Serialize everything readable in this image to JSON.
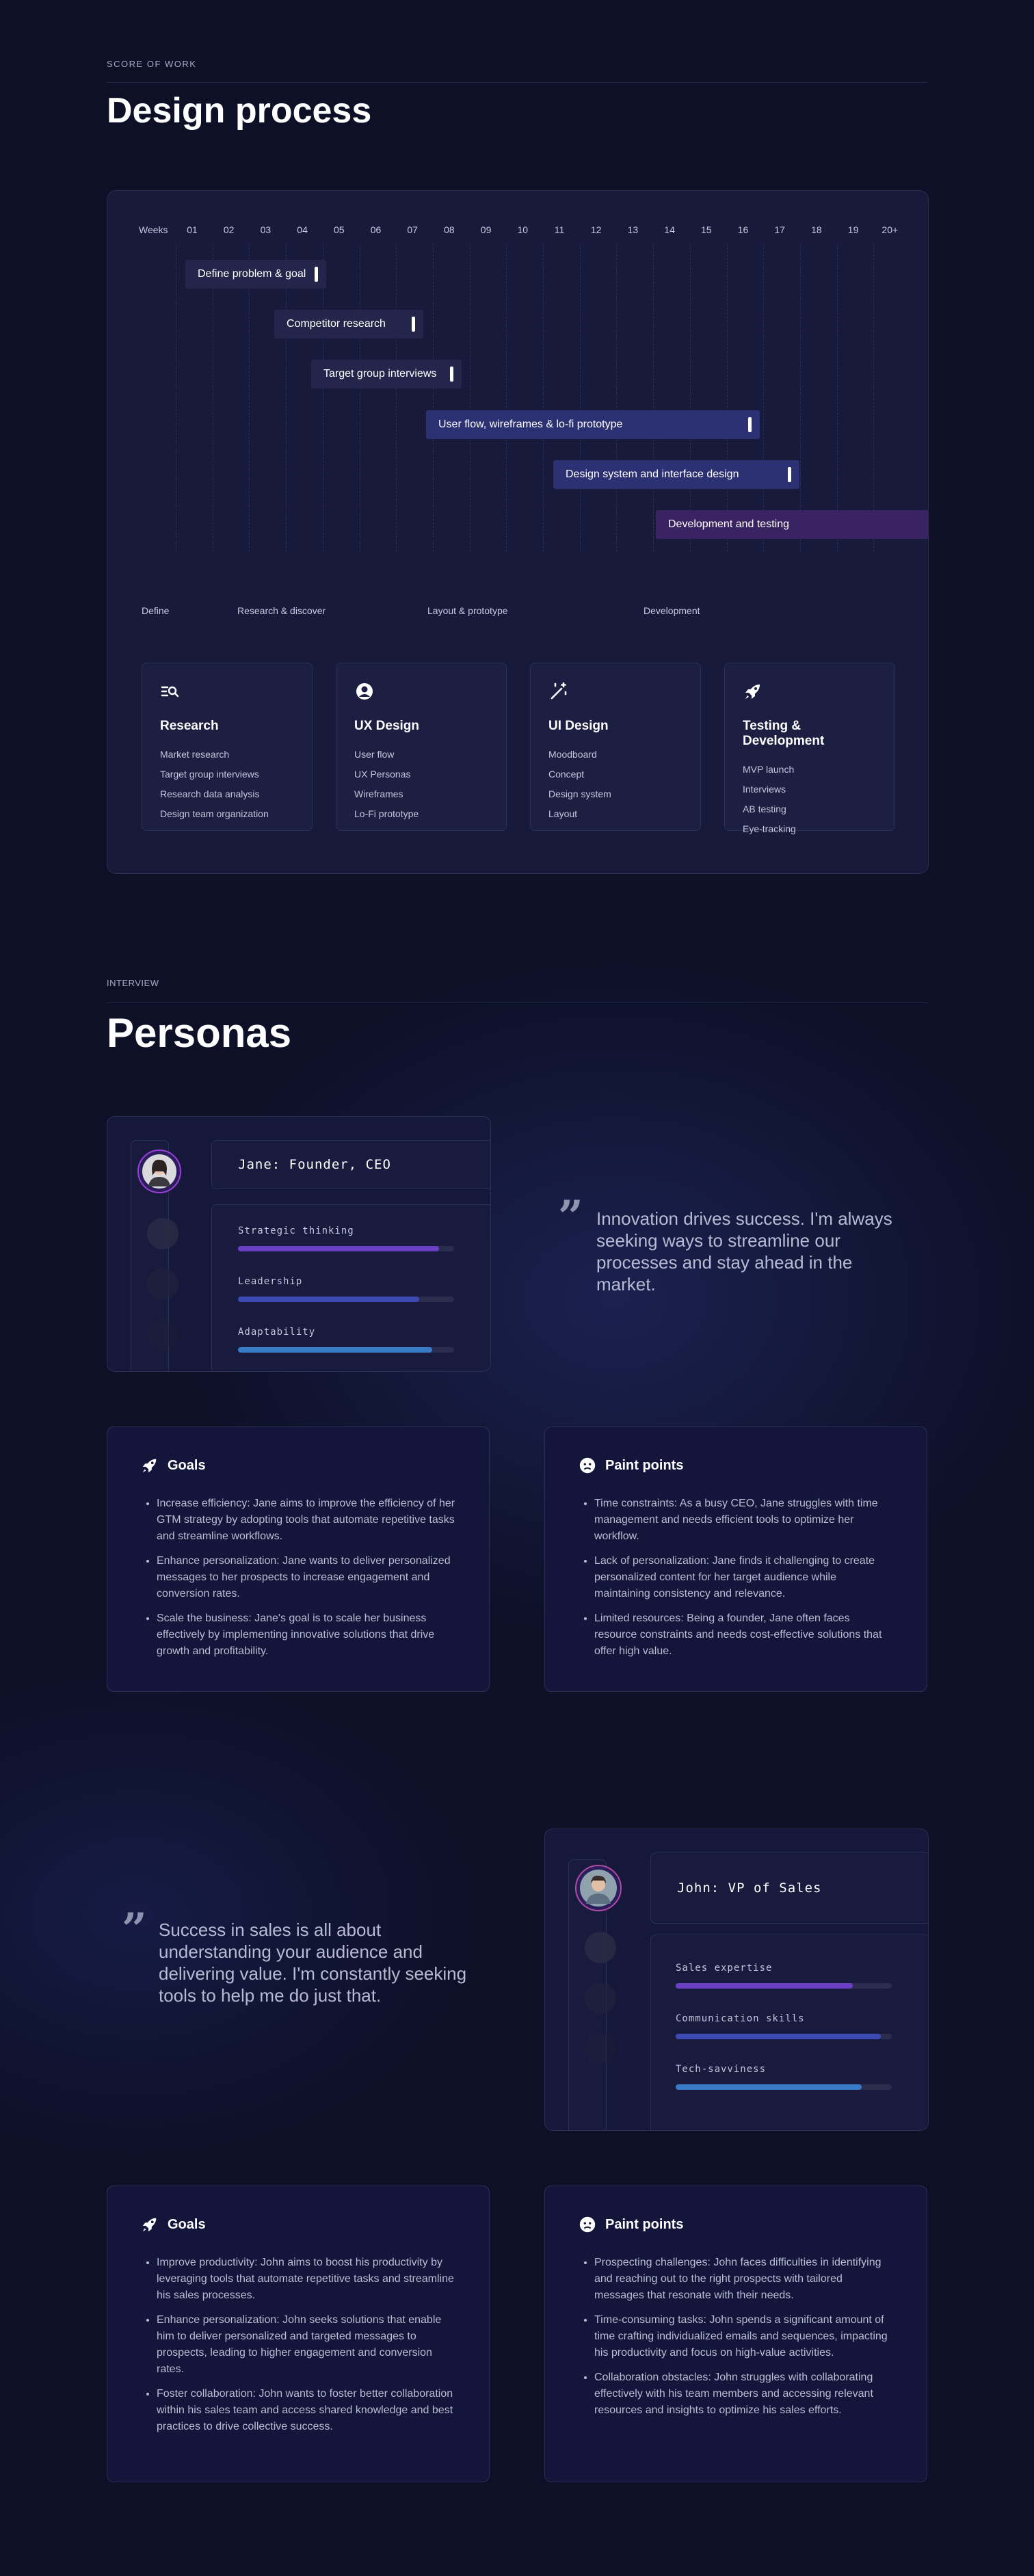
{
  "section1": {
    "eyebrow": "SCORE OF WORK",
    "title": "Design process"
  },
  "gantt": {
    "weeks_label": "Weeks",
    "weeks": [
      "01",
      "02",
      "03",
      "04",
      "05",
      "06",
      "07",
      "08",
      "09",
      "10",
      "11",
      "12",
      "13",
      "14",
      "15",
      "16",
      "17",
      "18",
      "19",
      "20+"
    ],
    "bars": [
      {
        "label": "Define problem & goal"
      },
      {
        "label": "Competitor research"
      },
      {
        "label": "Target group interviews"
      },
      {
        "label": "User flow, wireframes & lo-fi prototype"
      },
      {
        "label": "Design system and interface design"
      },
      {
        "label": "Development and testing"
      }
    ],
    "phases": [
      "Define",
      "Research & discover",
      "Layout & prototype",
      "Development"
    ],
    "categories": [
      {
        "icon": "search-list-icon",
        "title": "Research",
        "items": [
          "Market research",
          "Target group interviews",
          "Research data analysis",
          "Design team organization"
        ]
      },
      {
        "icon": "user-circle-icon",
        "title": "UX Design",
        "items": [
          "User flow",
          "UX Personas",
          "Wireframes",
          "Lo-Fi prototype"
        ]
      },
      {
        "icon": "magic-wand-icon",
        "title": "UI Design",
        "items": [
          "Moodboard",
          "Concept",
          "Design system",
          "Layout"
        ]
      },
      {
        "icon": "rocket-icon",
        "title": "Testing & Development",
        "items": [
          "MVP launch",
          "Interviews",
          "AB testing",
          "Eye-tracking"
        ]
      }
    ]
  },
  "section2": {
    "eyebrow": "INTERVIEW",
    "title": "Personas"
  },
  "persona1": {
    "name": "Jane: Founder, CEO",
    "skills": [
      {
        "label": "Strategic thinking",
        "value": 0.93,
        "color": "#6a3fc4"
      },
      {
        "label": "Leadership",
        "value": 0.84,
        "color": "#3d4ab3"
      },
      {
        "label": "Adaptability",
        "value": 0.9,
        "color": "#3a7bc8"
      }
    ],
    "quote": "Innovation drives success. I'm always seeking ways to streamline our processes and stay ahead in the market.",
    "goals_title": "Goals",
    "goals": [
      "Increase efficiency: Jane aims to improve the efficiency of her GTM strategy by adopting tools that automate repetitive tasks and streamline workflows.",
      "Enhance personalization: Jane wants to deliver personalized messages to her prospects to increase engagement and conversion rates.",
      "Scale the business: Jane's goal is to scale her business effectively by implementing innovative solutions that drive growth and profitability."
    ],
    "pain_title": "Paint points",
    "pains": [
      "Time constraints: As a busy CEO, Jane struggles with time management and needs efficient tools to optimize her workflow.",
      "Lack of personalization: Jane finds it challenging to create personalized content for her target audience while maintaining consistency and relevance.",
      "Limited resources: Being a founder, Jane often faces resource constraints and needs cost-effective solutions that offer high value."
    ]
  },
  "persona2": {
    "name": "John: VP of Sales",
    "skills": [
      {
        "label": "Sales expertise",
        "value": 0.82,
        "color": "#6a3fc4"
      },
      {
        "label": "Communication skills",
        "value": 0.95,
        "color": "#3d4ab3"
      },
      {
        "label": "Tech-savviness",
        "value": 0.86,
        "color": "#3a7bc8"
      }
    ],
    "quote": "Success in sales is all about understanding your audience and delivering value. I'm constantly seeking tools to help me do just that.",
    "goals_title": "Goals",
    "goals": [
      "Improve productivity: John aims to boost his productivity by leveraging tools that automate repetitive tasks and streamline his sales processes.",
      "Enhance personalization: John seeks solutions that enable him to deliver personalized and targeted messages to prospects, leading to higher engagement and conversion rates.",
      "Foster collaboration: John wants to foster better collaboration within his sales team and access shared knowledge and best practices to drive collective success."
    ],
    "pain_title": "Paint points",
    "pains": [
      "Prospecting challenges: John faces difficulties in identifying and reaching out to the right prospects with tailored messages that resonate with their needs.",
      "Time-consuming tasks: John spends a significant amount of time crafting individualized emails and sequences, impacting his productivity and focus on high-value activities.",
      "Collaboration obstacles: John struggles with collaborating effectively with his team members and accessing relevant resources and insights to optimize his sales efforts."
    ]
  }
}
